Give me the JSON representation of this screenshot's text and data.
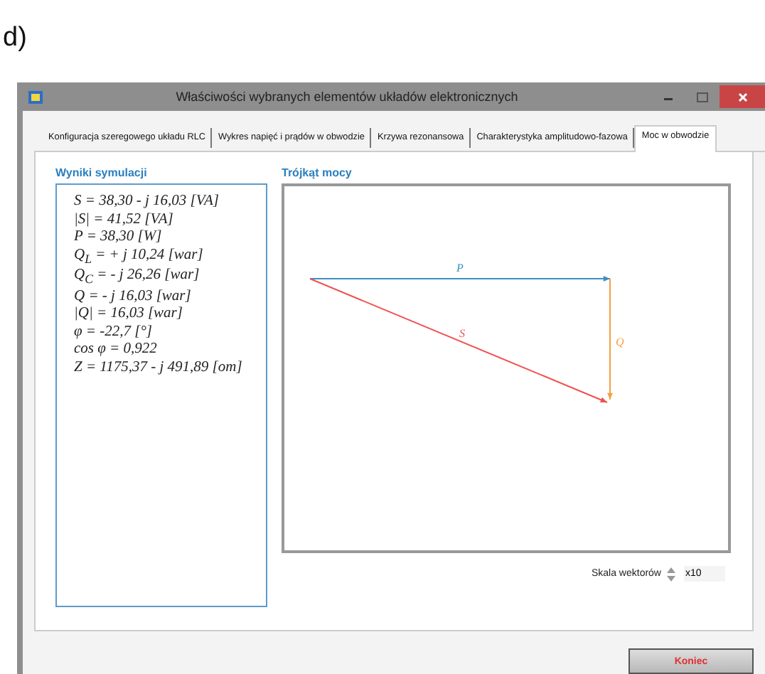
{
  "caption": "d)",
  "window": {
    "title": "Właściwości wybranych elementów układów elektronicznych"
  },
  "tabs": [
    {
      "label": "Konfiguracja szeregowego układu RLC",
      "selected": false
    },
    {
      "label": "Wykres napięć i prądów w obwodzie",
      "selected": false
    },
    {
      "label": "Krzywa rezonansowa",
      "selected": false
    },
    {
      "label": "Charakterystyka amplitudowo-fazowa",
      "selected": false
    },
    {
      "label": "Moc w obwodzie",
      "selected": true
    }
  ],
  "results": {
    "title": "Wyniki symulacji",
    "lines": [
      "S =  38,30 - j 16,03 [VA]",
      "|S| = 41,52 [VA]",
      "P = 38,30 [W]",
      "Q$_{L}$ = + j 10,24 [war]",
      "Q$_{C}$ = - j 26,26 [war]",
      "Q =  - j 16,03 [war]",
      "|Q| = 16,03 [war]",
      "φ = -22,7 [°]",
      "cos φ = 0,922",
      "Z = 1175,37 - j 491,89 [om]"
    ]
  },
  "triangle": {
    "title": "Trójkąt mocy",
    "vectors": [
      {
        "kind": "active",
        "label": "P",
        "color": "#3a8fc0"
      },
      {
        "kind": "reactive",
        "label": "Q",
        "color": "#f5a040"
      },
      {
        "kind": "apparent",
        "label": "S",
        "color": "#f05050"
      }
    ]
  },
  "scale": {
    "label": "Skala wektorów",
    "value": "x10"
  },
  "buttons": [
    "Koniec"
  ]
}
